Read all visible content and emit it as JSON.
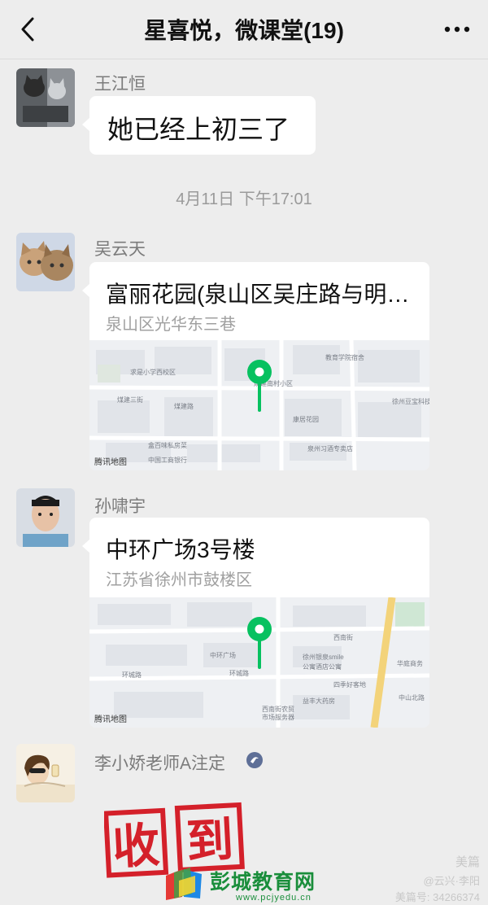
{
  "header": {
    "title": "星喜悦，微课堂(19)"
  },
  "messages": [
    {
      "sender": "王江恒",
      "text": "她已经上初三了"
    },
    {
      "sender": "吴云天",
      "location_title": "富丽花园(泉山区吴庄路与明…",
      "location_address": "泉山区光华东三巷",
      "map_label": "腾讯地图"
    },
    {
      "sender": "孙啸宇",
      "location_title": "中环广场3号楼",
      "location_address": "江苏省徐州市鼓楼区",
      "map_label": "腾讯地图"
    },
    {
      "sender": "李小娇老师A注定"
    }
  ],
  "timestamp": "4月11日 下午17:01",
  "stamp": {
    "chars": [
      "收",
      "到"
    ]
  },
  "watermark": {
    "site": "彭城教育网",
    "url": "www.pcjyedu.cn",
    "right_line1": "美篇",
    "right_line2": "@云兴·李阳",
    "right_line3": "美篇号: 34266374"
  },
  "colors": {
    "pin": "#07c160",
    "background": "#ededed",
    "bubble": "#ffffff"
  }
}
